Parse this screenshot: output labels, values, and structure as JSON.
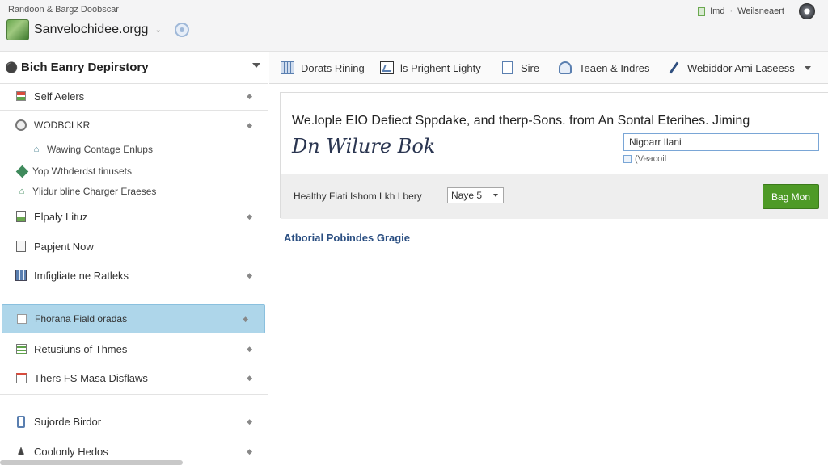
{
  "window": {
    "app_title": "Randoon & Bargz Doobscar",
    "site_name": "Sanvelochidee.orgg",
    "site_chevron": "⌄",
    "user_text": "Imd",
    "user_name": "Weilsneaert"
  },
  "sidebar": {
    "title": "Bich Eanry Depirstory",
    "items": [
      {
        "label": "Self Aelers",
        "icon": "flag-icon"
      },
      {
        "label": "WODBCLKR",
        "icon": "circle-icon"
      },
      {
        "label": "Wawing Contage Enlups",
        "icon": "house-icon"
      },
      {
        "label": "Yop Wthderdst tinusets",
        "icon": "diamond-icon"
      },
      {
        "label": "Ylidur bline Charger Eraeses",
        "icon": "house-icon"
      },
      {
        "label": "Elpaly Lituz",
        "icon": "document-icon"
      },
      {
        "label": "Papjent Now",
        "icon": "page-icon"
      },
      {
        "label": "Imfigliate ne Ratleks",
        "icon": "chart-icon"
      },
      {
        "label": "Fhorana Fiald oradas",
        "icon": "square-icon"
      },
      {
        "label": "Retusiuns of Thmes",
        "icon": "list-icon"
      },
      {
        "label": "Thers FS Masa Disflaws",
        "icon": "calendar-icon"
      },
      {
        "label": "Sujorde Birdor",
        "icon": "phone-icon"
      },
      {
        "label": "Coolonly Hedos",
        "icon": "person-icon"
      }
    ]
  },
  "toolbar": {
    "items": [
      {
        "label": "Dorats Rining",
        "icon": "grid-icon"
      },
      {
        "label": "ls Prighent Lighty",
        "icon": "chart-icon"
      },
      {
        "label": "Sire",
        "icon": "page-icon"
      },
      {
        "label": "Teaen & Indres",
        "icon": "people-icon"
      },
      {
        "label": "Webiddor Ami Laseess",
        "icon": "pen-icon"
      }
    ]
  },
  "content": {
    "heading": "We.lople EIO Defiect Sppdake, and therp-Sons. from An Sontal Eterihes. Jiming",
    "script_title": "Dn Wilure Bok",
    "input_value": "Nigoarr Ilani",
    "helper_text": "(Veacoil",
    "filter_label": "Healthy Fiati Ishom Lkh Lbery",
    "select_value": "Naye 5",
    "go_button": "Bag Mon",
    "section_link": "Atborial Pobindes Gragie"
  },
  "colors": {
    "accent_green": "#4e9a26",
    "selected_row": "#aed6ea",
    "link_blue": "#2b4f82"
  }
}
